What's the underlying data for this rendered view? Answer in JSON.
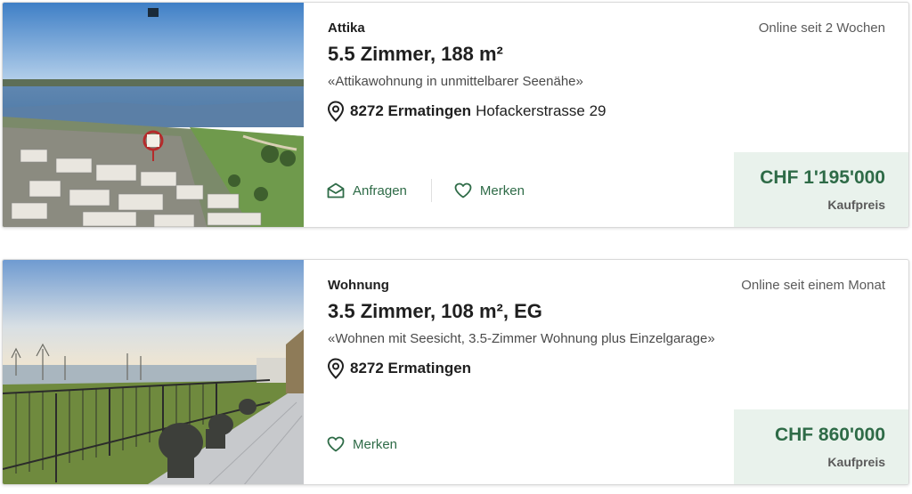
{
  "listings": [
    {
      "type": "Attika",
      "online": "Online seit 2 Wochen",
      "title": "5.5 Zimmer, 188 m²",
      "description": "«Attikawohnung in unmittelbarer Seenähe»",
      "zip_city": "8272 Ermatingen",
      "street": "Hofackerstrasse 29",
      "actions": {
        "inquire": "Anfragen",
        "save": "Merken"
      },
      "price": "CHF 1'195'000",
      "price_type": "Kaufpreis"
    },
    {
      "type": "Wohnung",
      "online": "Online seit einem Monat",
      "title": "3.5 Zimmer, 108 m², EG",
      "description": "«Wohnen mit Seesicht, 3.5-Zimmer Wohnung plus Einzelgarage»",
      "zip_city": "8272 Ermatingen",
      "street": "",
      "actions": {
        "save": "Merken"
      },
      "price": "CHF 860'000",
      "price_type": "Kaufpreis"
    }
  ],
  "colors": {
    "accent": "#2e6b47",
    "price_bg": "#e9f2ec"
  }
}
